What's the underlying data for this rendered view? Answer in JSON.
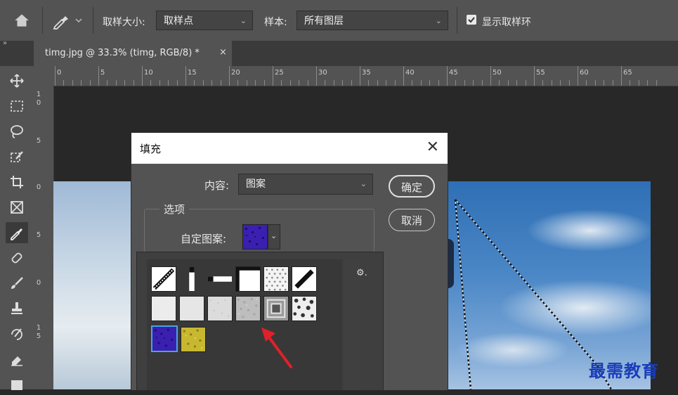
{
  "options_bar": {
    "sample_size_label": "取样大小:",
    "sample_size_value": "取样点",
    "sample_label": "样本:",
    "sample_value": "所有图层",
    "show_ring_label": "显示取样环",
    "show_ring_checked": true
  },
  "document_tab": {
    "title": "timg.jpg @ 33.3% (timg, RGB/8) *",
    "close": "×"
  },
  "ruler": {
    "h_labels": [
      "0",
      "5",
      "10",
      "15",
      "20",
      "25",
      "30",
      "35",
      "40",
      "45",
      "50",
      "55",
      "60",
      "65"
    ],
    "v_labels": [
      "1",
      "0",
      "5",
      "0",
      "5",
      "0",
      "1",
      "5"
    ]
  },
  "fill_dialog": {
    "title": "填充",
    "close": "✕",
    "content_label": "内容:",
    "content_value": "图案",
    "options_legend": "选项",
    "custom_pattern_label": "自定图案:",
    "ok_label": "确定",
    "cancel_label": "取消"
  },
  "pattern_picker": {
    "gear": "⚙.",
    "selected_pattern": "purple-noise-pattern"
  },
  "colors": {
    "accent_arrow": "#e0202a",
    "selected_swatch": "#4aa3df",
    "purple_pattern": "#3a1fb0",
    "yellow_pattern": "#c8b830",
    "watermark": "#1a3db8"
  },
  "watermark": "最需教育"
}
